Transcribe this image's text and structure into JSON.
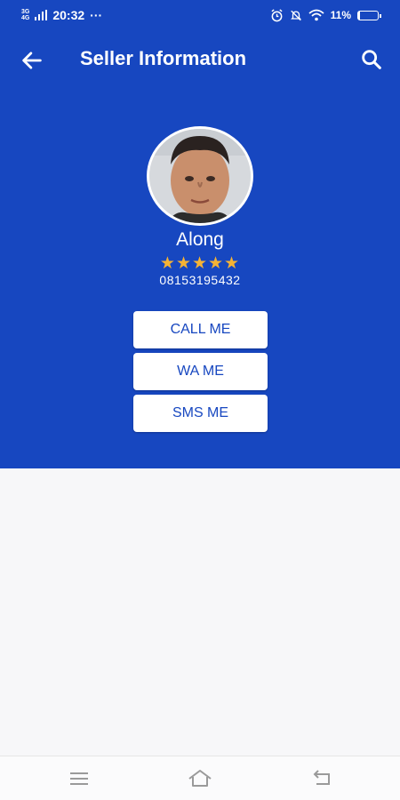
{
  "status_bar": {
    "network_top": "3G",
    "network_bottom": "4G",
    "time": "20:32",
    "extra": "···",
    "battery": "11%",
    "battery_level": 0.11,
    "icons": [
      "alarm-icon",
      "mute-icon",
      "wifi-icon",
      "battery-icon"
    ]
  },
  "header": {
    "title": "Seller Information",
    "back_icon": "arrow-left-icon",
    "search_icon": "search-icon"
  },
  "seller": {
    "name": "Along",
    "rating": 5,
    "stars": "★★★★★",
    "phone": "08153195432"
  },
  "actions": {
    "call": "CALL ME",
    "wa": "WA ME",
    "sms": "SMS ME"
  },
  "nav": {
    "icons": [
      "menu-icon",
      "home-icon",
      "back-icon"
    ]
  },
  "colors": {
    "primary": "#1747c0",
    "star": "#f5b335",
    "background": "#f7f7f9"
  }
}
